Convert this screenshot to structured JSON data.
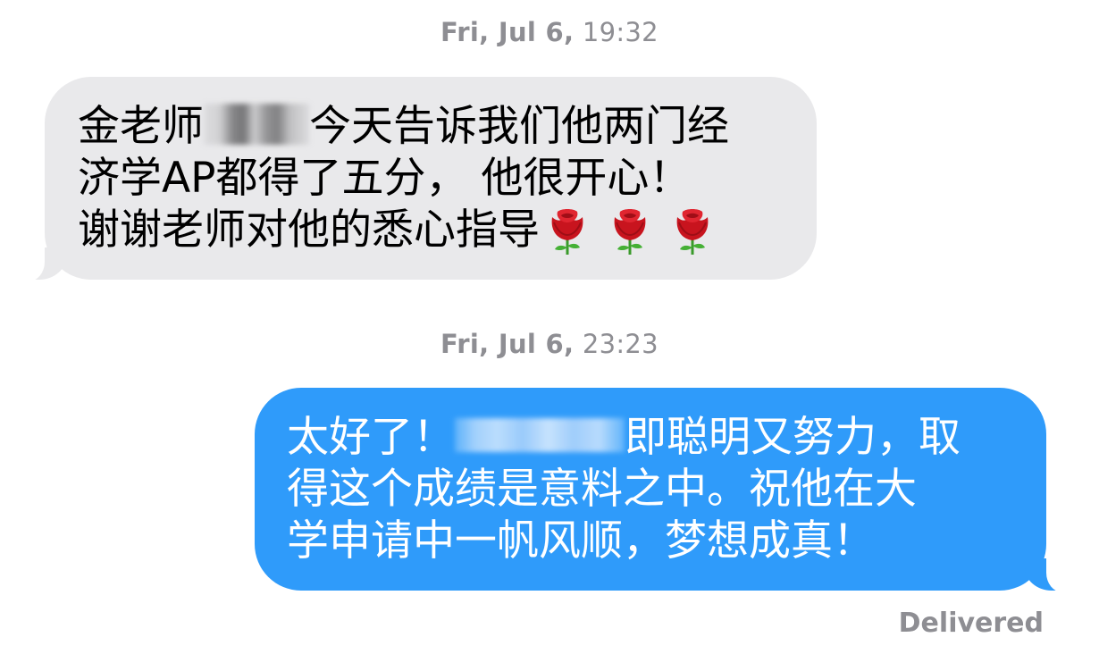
{
  "conversation": {
    "timestamps": [
      {
        "day": "Fri, Jul 6,",
        "time": "19:32"
      },
      {
        "day": "Fri, Jul 6,",
        "time": "23:23"
      }
    ],
    "incoming_message": {
      "line1_before_blur": "金老师",
      "line1_after_blur": "今天告诉我们他两门经",
      "line2": "济学AP都得了五分， 他很开心！",
      "line3": "谢谢老师对他的悉心指导",
      "emoji_icons": [
        "rose-icon",
        "rose-icon",
        "rose-icon"
      ]
    },
    "outgoing_message": {
      "line1_before_blur": "太好了！",
      "line1_after_blur": "即聪明又努力，取",
      "line2": "得这个成绩是意料之中。祝他在大",
      "line3": "学申请中一帆风顺，梦想成真！"
    },
    "status": "Delivered"
  },
  "colors": {
    "incoming_bubble": "#e9e9eb",
    "outgoing_bubble": "#2f9bfa",
    "timestamp_text": "#8e8e93"
  }
}
